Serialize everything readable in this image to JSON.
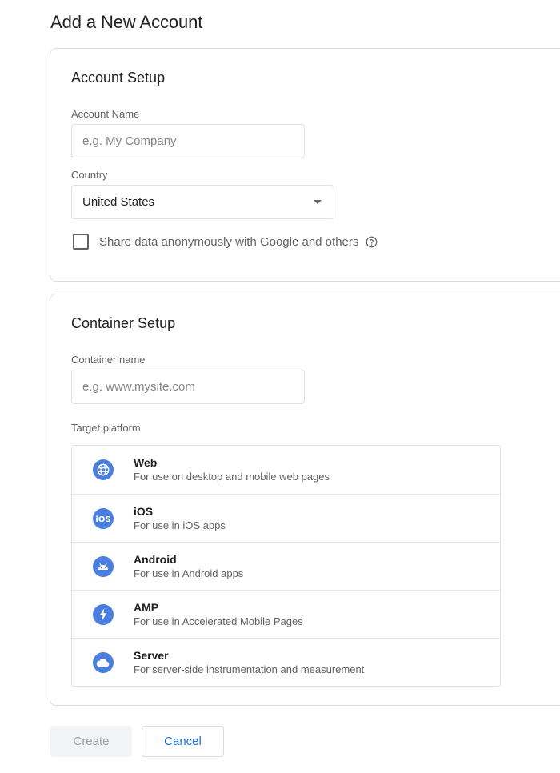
{
  "page": {
    "title": "Add a New Account"
  },
  "account_setup": {
    "title": "Account Setup",
    "account_name": {
      "label": "Account Name",
      "value": "",
      "placeholder": "e.g. My Company"
    },
    "country": {
      "label": "Country",
      "selected": "United States"
    },
    "share_data": {
      "label": "Share data anonymously with Google and others",
      "checked": false,
      "help_icon": "help-circle-icon"
    }
  },
  "container_setup": {
    "title": "Container Setup",
    "container_name": {
      "label": "Container name",
      "value": "",
      "placeholder": "e.g. www.mysite.com"
    },
    "target_platform": {
      "label": "Target platform",
      "options": [
        {
          "name": "Web",
          "description": "For use on desktop and mobile web pages",
          "icon": "globe-icon"
        },
        {
          "name": "iOS",
          "description": "For use in iOS apps",
          "icon": "ios-icon"
        },
        {
          "name": "Android",
          "description": "For use in Android apps",
          "icon": "android-icon"
        },
        {
          "name": "AMP",
          "description": "For use in Accelerated Mobile Pages",
          "icon": "lightning-icon"
        },
        {
          "name": "Server",
          "description": "For server-side instrumentation and measurement",
          "icon": "cloud-icon"
        }
      ]
    }
  },
  "actions": {
    "create_label": "Create",
    "create_enabled": false,
    "cancel_label": "Cancel"
  },
  "colors": {
    "accent": "#1a73e8",
    "icon_blue": "#4a7fe0",
    "border": "#dadce0",
    "muted_text": "#5f6368"
  }
}
